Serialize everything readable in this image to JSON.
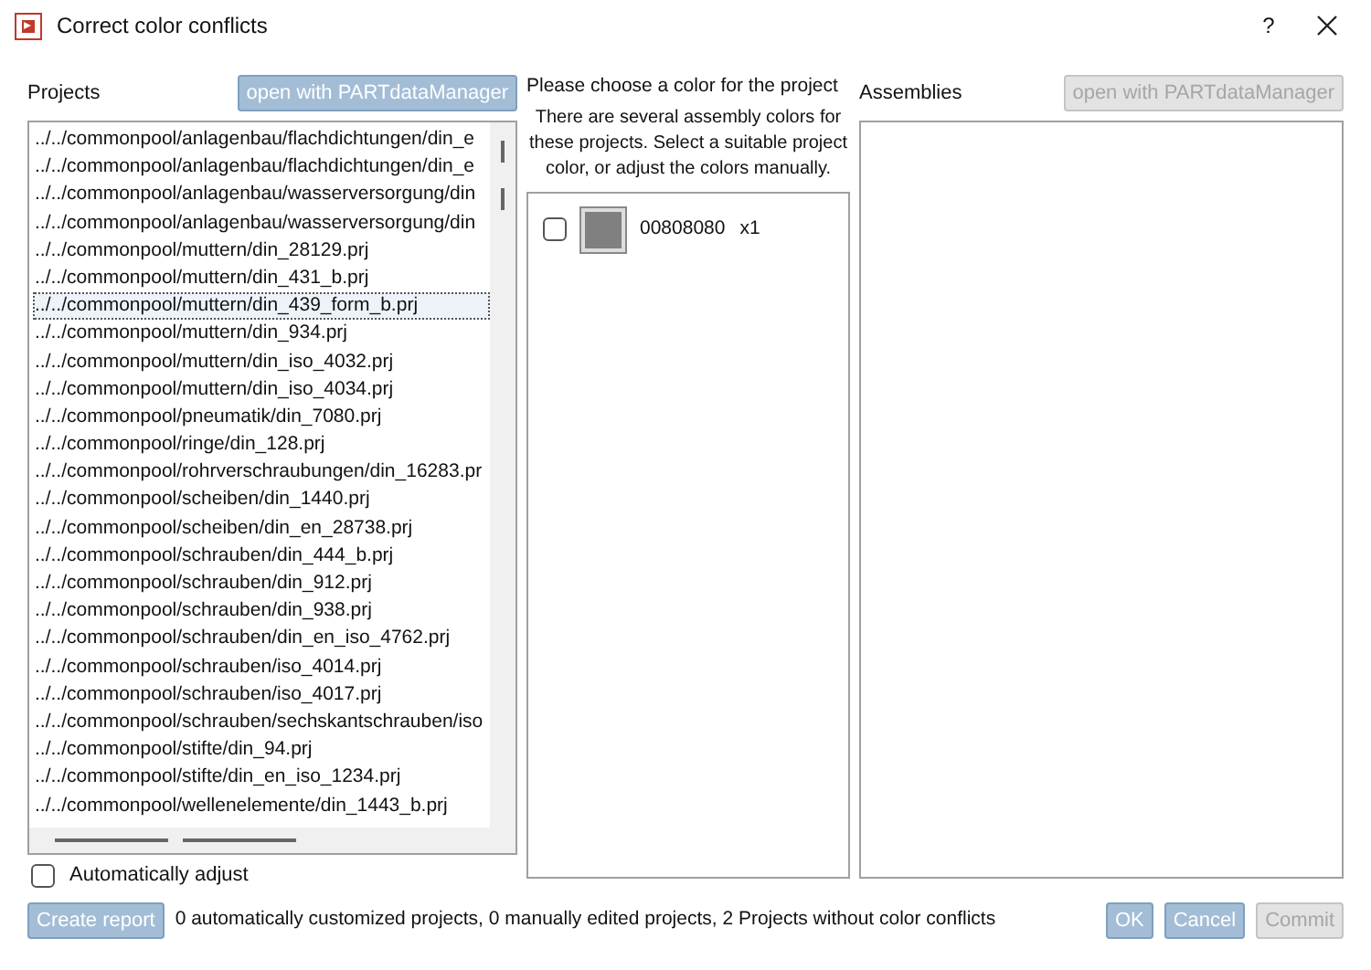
{
  "window": {
    "title": "Correct color conflicts",
    "help": "?"
  },
  "projects": {
    "label": "Projects",
    "button": {
      "label": "open with PARTdataManager",
      "disabled": false
    },
    "items": [
      {
        "text": "../../commonpool/anlagenbau/flachdichtungen/din_e",
        "selected": false
      },
      {
        "text": "../../commonpool/anlagenbau/flachdichtungen/din_e",
        "selected": false
      },
      {
        "text": "../../commonpool/anlagenbau/wasserversorgung/din",
        "selected": false
      },
      {
        "text": "../../commonpool/anlagenbau/wasserversorgung/din",
        "selected": false
      },
      {
        "text": "../../commonpool/muttern/din_28129.prj",
        "selected": false
      },
      {
        "text": "../../commonpool/muttern/din_431_b.prj",
        "selected": false
      },
      {
        "text": "../../commonpool/muttern/din_439_form_b.prj",
        "selected": true
      },
      {
        "text": "../../commonpool/muttern/din_934.prj",
        "selected": false
      },
      {
        "text": "../../commonpool/muttern/din_iso_4032.prj",
        "selected": false
      },
      {
        "text": "../../commonpool/muttern/din_iso_4034.prj",
        "selected": false
      },
      {
        "text": "../../commonpool/pneumatik/din_7080.prj",
        "selected": false
      },
      {
        "text": "../../commonpool/ringe/din_128.prj",
        "selected": false
      },
      {
        "text": "../../commonpool/rohrverschraubungen/din_16283.pr",
        "selected": false
      },
      {
        "text": "../../commonpool/scheiben/din_1440.prj",
        "selected": false
      },
      {
        "text": "../../commonpool/scheiben/din_en_28738.prj",
        "selected": false
      },
      {
        "text": "../../commonpool/schrauben/din_444_b.prj",
        "selected": false
      },
      {
        "text": "../../commonpool/schrauben/din_912.prj",
        "selected": false
      },
      {
        "text": "../../commonpool/schrauben/din_938.prj",
        "selected": false
      },
      {
        "text": "../../commonpool/schrauben/din_en_iso_4762.prj",
        "selected": false
      },
      {
        "text": "../../commonpool/schrauben/iso_4014.prj",
        "selected": false
      },
      {
        "text": "../../commonpool/schrauben/iso_4017.prj",
        "selected": false
      },
      {
        "text": "../../commonpool/schrauben/sechskantschrauben/iso",
        "selected": false
      },
      {
        "text": "../../commonpool/stifte/din_94.prj",
        "selected": false
      },
      {
        "text": "../../commonpool/stifte/din_en_iso_1234.prj",
        "selected": false
      },
      {
        "text": "../../commonpool/wellenelemente/din_1443_b.prj",
        "selected": false
      }
    ]
  },
  "colors": {
    "heading": "Please choose a color for the project",
    "info": "There are several assembly colors for these projects. Select a suitable project color, or adjust the colors manually.",
    "items": [
      {
        "code": "00808080",
        "count": "x1",
        "checked": false,
        "color": "#808080"
      }
    ]
  },
  "assemblies": {
    "label": "Assemblies",
    "button": {
      "label": "open with PARTdataManager",
      "disabled": true
    }
  },
  "auto_adjust": {
    "label": "Automatically adjust",
    "checked": false
  },
  "footer": {
    "report_button": {
      "label": "Create report",
      "disabled": false
    },
    "status": "0 automatically customized projects, 0 manually edited projects, 2 Projects without color conflicts",
    "buttons": [
      {
        "label": "OK",
        "disabled": false
      },
      {
        "label": "Cancel",
        "disabled": false
      },
      {
        "label": "Commit",
        "disabled": true
      }
    ]
  }
}
